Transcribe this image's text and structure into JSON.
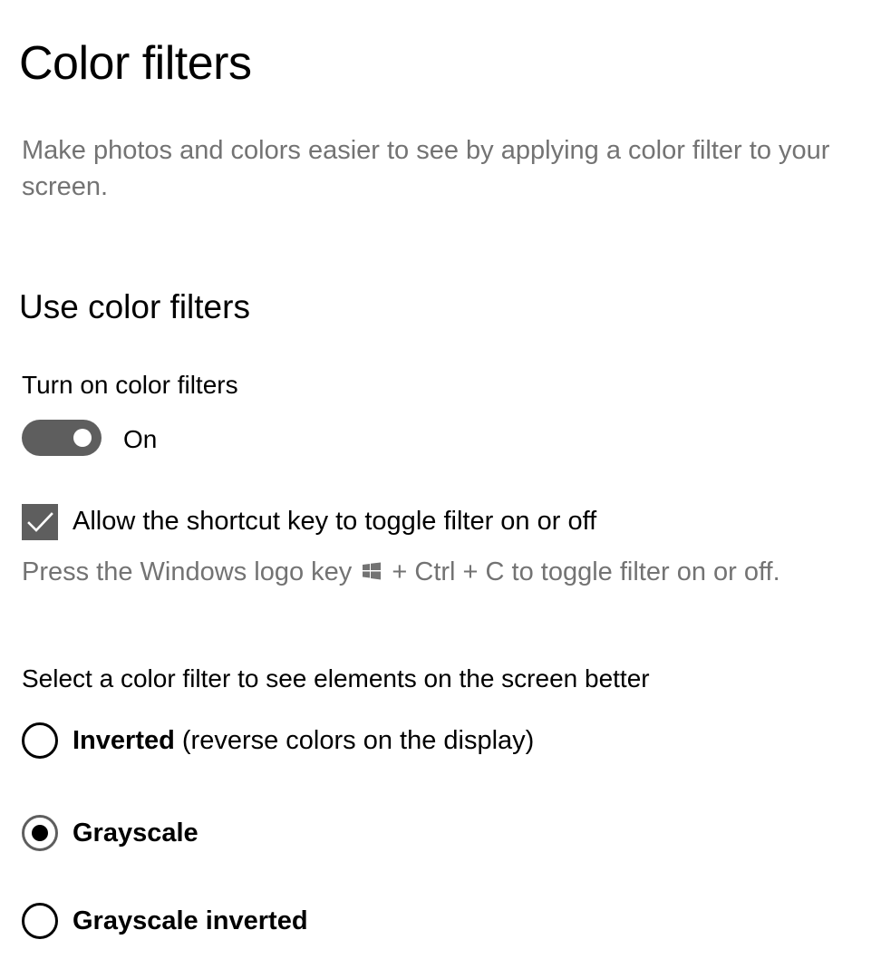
{
  "page": {
    "title": "Color filters",
    "description": "Make photos and colors easier to see by applying a color filter to your screen."
  },
  "section": {
    "title": "Use color filters"
  },
  "toggle": {
    "label": "Turn on color filters",
    "state_text": "On",
    "on": true
  },
  "shortcut": {
    "checkbox_label": "Allow the shortcut key to toggle filter on or off",
    "checked": true,
    "hint_before": "Press the Windows logo key",
    "hint_icon": "windows-logo-icon",
    "hint_after": "+ Ctrl + C to toggle filter on or off."
  },
  "filters": {
    "prompt": "Select a color filter to see elements on the screen better",
    "options": [
      {
        "name": "Inverted",
        "detail": "(reverse colors on the display)",
        "selected": false
      },
      {
        "name": "Grayscale",
        "detail": "",
        "selected": true
      },
      {
        "name": "Grayscale inverted",
        "detail": "",
        "selected": false
      }
    ]
  },
  "colors": {
    "control_fill": "#5e5e5e",
    "secondary_text": "#737373",
    "primary_text": "#000000"
  }
}
